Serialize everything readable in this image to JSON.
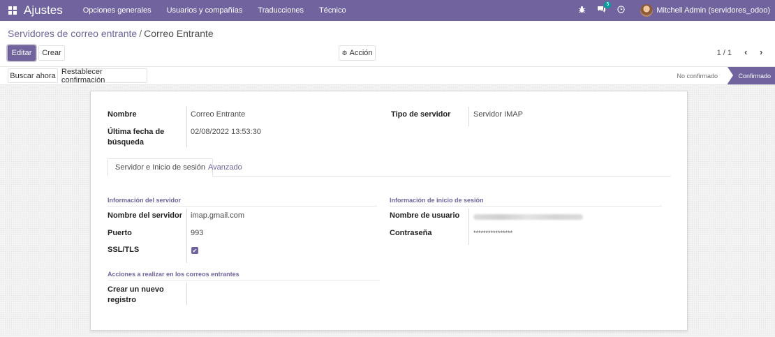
{
  "navbar": {
    "app_title": "Ajustes",
    "menu": [
      "Opciones generales",
      "Usuarios y compañías",
      "Traducciones",
      "Técnico"
    ],
    "messages_count": "5",
    "user": "Mitchell Admin (servidores_odoo)"
  },
  "breadcrumb": {
    "parent": "Servidores de correo entrante",
    "separator": "/",
    "current": "Correo Entrante"
  },
  "toolbar": {
    "edit_label": "Editar",
    "create_label": "Crear",
    "action_label": "Acción",
    "pager": "1 / 1"
  },
  "statusbar": {
    "fetch_now_label": "Buscar ahora",
    "reset_label": "Restablecer confirmación",
    "steps": [
      "No confirmado",
      "Confirmado"
    ],
    "active_step": "Confirmado"
  },
  "form": {
    "name_label": "Nombre",
    "name_value": "Correo Entrante",
    "last_fetch_label": "Última fecha de búsqueda",
    "last_fetch_value": "02/08/2022 13:53:30",
    "server_type_label": "Tipo de servidor",
    "server_type_value": "Servidor IMAP",
    "tabs": [
      "Servidor e Inicio de sesión",
      "Avanzado"
    ],
    "server_info_title": "Información del servidor",
    "server_name_label": "Nombre del servidor",
    "server_name_value": "imap.gmail.com",
    "port_label": "Puerto",
    "port_value": "993",
    "ssl_label": "SSL/TLS",
    "ssl_checked": true,
    "login_info_title": "Información de inicio de sesión",
    "username_label": "Nombre de usuario",
    "password_label": "Contraseña",
    "password_value": "****************",
    "actions_title": "Acciones a realizar en los correos entrantes",
    "create_record_label": "Crear un nuevo registro"
  },
  "colors": {
    "brand": "#71639e",
    "badge": "#00a09d"
  }
}
